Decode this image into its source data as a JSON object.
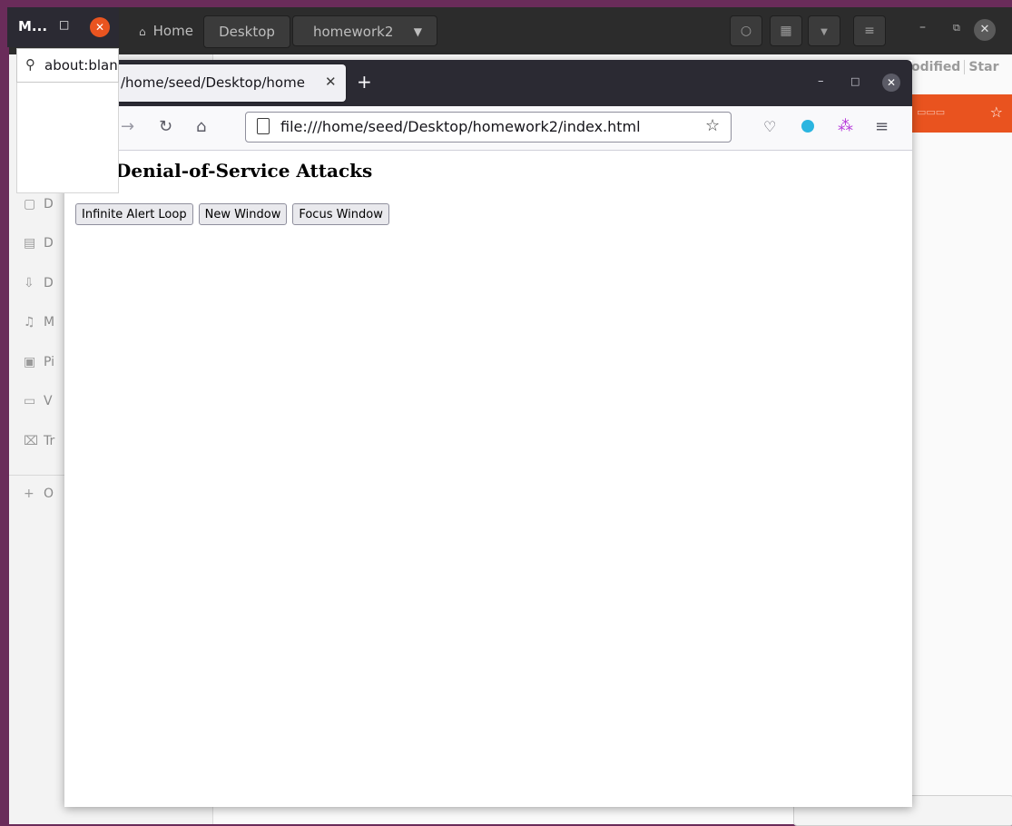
{
  "file_manager": {
    "path": [
      "Home",
      "Desktop",
      "homework2"
    ],
    "columns": [
      "odified",
      "Star"
    ],
    "sidebar_items": [
      {
        "icon": "folder-icon",
        "label": "D"
      },
      {
        "icon": "document-icon",
        "label": "D"
      },
      {
        "icon": "download-icon",
        "label": "D"
      },
      {
        "icon": "music-icon",
        "label": "M"
      },
      {
        "icon": "picture-icon",
        "label": "Pi"
      },
      {
        "icon": "video-icon",
        "label": "V"
      },
      {
        "icon": "trash-icon",
        "label": "Tr"
      },
      {
        "icon": "plus-icon",
        "label": "O"
      }
    ]
  },
  "browser": {
    "tab_title": "/home/seed/Desktop/home",
    "url": "file:///home/seed/Desktop/homework2/index.html"
  },
  "page": {
    "heading": "Denial-of-Service Attacks",
    "buttons": [
      "Infinite Alert Loop",
      "New Window",
      "Focus Window"
    ]
  },
  "popup": {
    "title": "M...",
    "url": "about:blank"
  }
}
